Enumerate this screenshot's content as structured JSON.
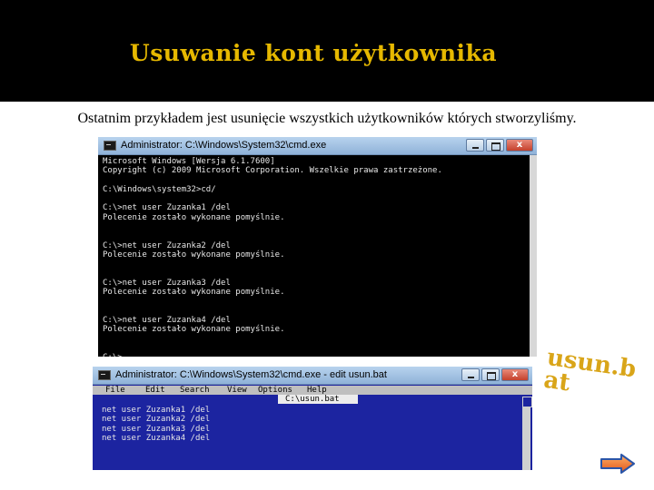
{
  "slide": {
    "title": "Usuwanie kont użytkownika",
    "subtitle": "Ostatnim przykładem jest usunięcie wszystkich użytkowników których stworzyliśmy."
  },
  "window1": {
    "title": "Administrator: C:\\Windows\\System32\\cmd.exe",
    "close_label": "x",
    "lines": [
      "Microsoft Windows [Wersja 6.1.7600]",
      "Copyright (c) 2009 Microsoft Corporation. Wszelkie prawa zastrzeżone.",
      "",
      "C:\\Windows\\system32>cd/",
      "",
      "C:\\>net user Zuzanka1 /del",
      "Polecenie zostało wykonane pomyślnie.",
      "",
      "",
      "C:\\>net user Zuzanka2 /del",
      "Polecenie zostało wykonane pomyślnie.",
      "",
      "",
      "C:\\>net user Zuzanka3 /del",
      "Polecenie zostało wykonane pomyślnie.",
      "",
      "",
      "C:\\>net user Zuzanka4 /del",
      "Polecenie zostało wykonane pomyślnie.",
      "",
      ""
    ],
    "prompt": "C:\\>"
  },
  "window2": {
    "title": "Administrator: C:\\Windows\\System32\\cmd.exe - edit usun.bat",
    "close_label": "x",
    "menu": [
      "File",
      "Edit",
      "Search",
      "View",
      "Options",
      "Help"
    ],
    "file_tab": "C:\\usun.bat",
    "lines": [
      "net user Zuzanka1 /del",
      "net user Zuzanka2 /del",
      "net user Zuzanka3 /del",
      "net user Zuzanka4 /del"
    ]
  },
  "overlay": {
    "line1": "usun.b",
    "line2": "at"
  },
  "icons": {
    "next": "arrow-right-icon"
  },
  "colors": {
    "header_bg": "#000000",
    "title": "#e6b800",
    "console_bg": "#000000",
    "editor_bg": "#1c24a0",
    "overlay": "#d9a519",
    "next_button": "#f0732a"
  }
}
